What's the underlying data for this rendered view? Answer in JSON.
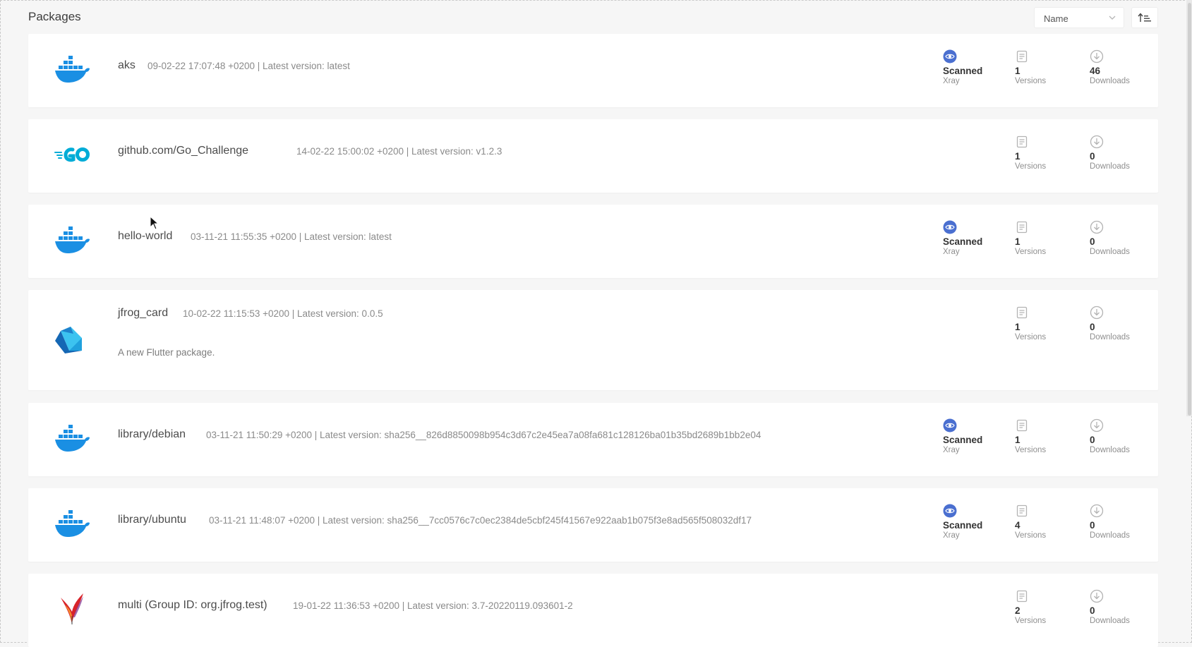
{
  "header": {
    "title": "Packages",
    "sort": {
      "value": "Name"
    }
  },
  "colors": {
    "accent": "#4a6fd0",
    "docker": "#1a8fe3",
    "go": "#00acd7",
    "dart_dark": "#1567b4",
    "dart_light": "#3cc3f0"
  },
  "packages": [
    {
      "name": "aks",
      "icon": "docker-icon",
      "meta": "09-02-22 17:07:48 +0200 | Latest version: latest",
      "scanned": true,
      "scanned_label": "Scanned",
      "scanned_sub": "Xray",
      "versions": "1",
      "versions_label": "Versions",
      "downloads": "46",
      "downloads_label": "Downloads"
    },
    {
      "name": "github.com/Go_Challenge",
      "icon": "go-icon",
      "meta": "14-02-22 15:00:02 +0200 | Latest version: v1.2.3",
      "scanned": false,
      "versions": "1",
      "versions_label": "Versions",
      "downloads": "0",
      "downloads_label": "Downloads"
    },
    {
      "name": "hello-world",
      "icon": "docker-icon",
      "meta": "03-11-21 11:55:35 +0200 | Latest version: latest",
      "scanned": true,
      "scanned_label": "Scanned",
      "scanned_sub": "Xray",
      "versions": "1",
      "versions_label": "Versions",
      "downloads": "0",
      "downloads_label": "Downloads"
    },
    {
      "name": "jfrog_card",
      "icon": "dart-icon",
      "meta": "10-02-22 11:15:53 +0200 | Latest version: 0.0.5",
      "description": "A new Flutter package.",
      "scanned": false,
      "versions": "1",
      "versions_label": "Versions",
      "downloads": "0",
      "downloads_label": "Downloads"
    },
    {
      "name": "library/debian",
      "icon": "docker-icon",
      "meta": "03-11-21 11:50:29 +0200 | Latest version: sha256__826d8850098b954c3d67c2e45ea7a08fa681c128126ba01b35bd2689b1bb2e04",
      "scanned": true,
      "scanned_label": "Scanned",
      "scanned_sub": "Xray",
      "versions": "1",
      "versions_label": "Versions",
      "downloads": "0",
      "downloads_label": "Downloads"
    },
    {
      "name": "library/ubuntu",
      "icon": "docker-icon",
      "meta": "03-11-21 11:48:07 +0200 | Latest version: sha256__7cc0576c7c0ec2384de5cbf245f41567e922aab1b075f3e8ad565f508032df17",
      "scanned": true,
      "scanned_label": "Scanned",
      "scanned_sub": "Xray",
      "versions": "4",
      "versions_label": "Versions",
      "downloads": "0",
      "downloads_label": "Downloads"
    },
    {
      "name": "multi (Group ID: org.jfrog.test)",
      "icon": "maven-feather-icon",
      "meta": "19-01-22 11:36:53 +0200 | Latest version: 3.7-20220119.093601-2",
      "scanned": false,
      "versions": "2",
      "versions_label": "Versions",
      "downloads": "0",
      "downloads_label": "Downloads"
    }
  ]
}
